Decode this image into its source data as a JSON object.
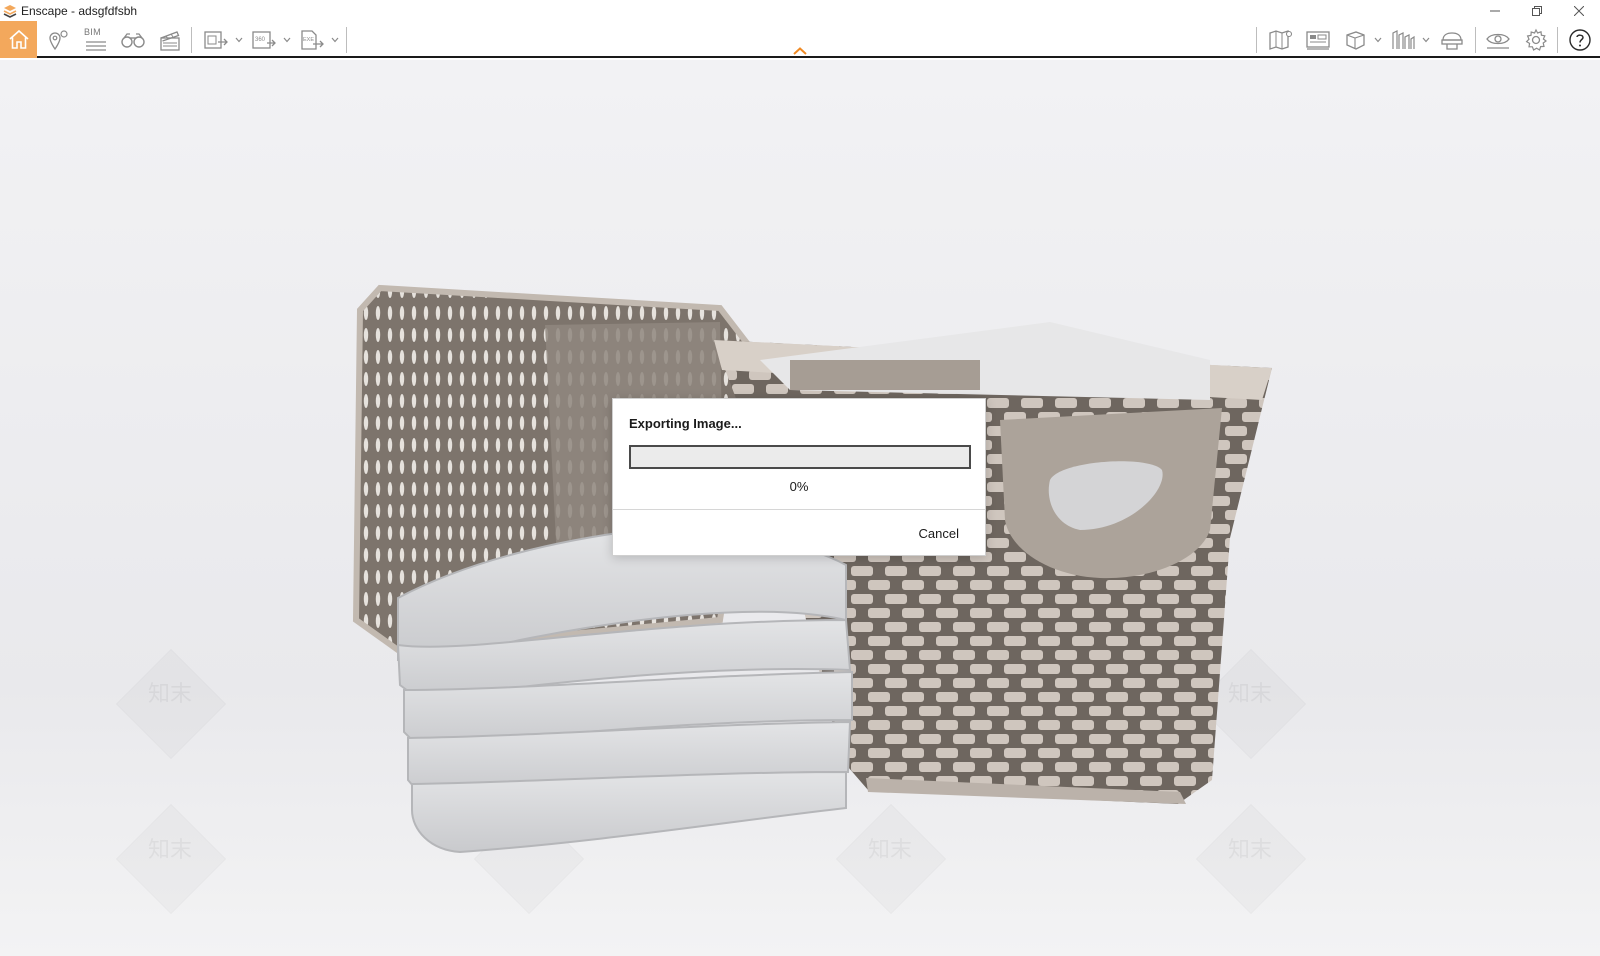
{
  "window": {
    "title": "Enscape - adsgfdfsbh"
  },
  "colors": {
    "accent": "#f3a85c",
    "toolbar_border": "#1a1a1a",
    "icon_gray": "#8a8a8a"
  },
  "toolbar": {
    "left_items": [
      {
        "name": "home-icon",
        "active": true
      },
      {
        "name": "location-pin-icon"
      },
      {
        "name": "bim-icon",
        "label": "BIM"
      },
      {
        "name": "binoculars-icon"
      },
      {
        "name": "clapperboard-icon"
      },
      {
        "name": "screenshot-export-icon",
        "has_dropdown": true
      },
      {
        "name": "panorama-360-icon",
        "has_dropdown": true
      },
      {
        "name": "exe-export-icon",
        "has_dropdown": true
      }
    ],
    "right_items": [
      {
        "name": "map-icon"
      },
      {
        "name": "asset-library-icon"
      },
      {
        "name": "cube-view-icon",
        "has_dropdown": true
      },
      {
        "name": "section-icon",
        "has_dropdown": true
      },
      {
        "name": "hat-icon"
      },
      {
        "name": "eye-icon"
      },
      {
        "name": "settings-gear-icon"
      },
      {
        "name": "help-icon"
      }
    ]
  },
  "render": {
    "subject": "woven-basket-with-folded-towels",
    "watermark_text": "知末"
  },
  "export_dialog": {
    "title": "Exporting Image...",
    "progress_value": 0,
    "progress_text": "0%",
    "cancel_label": "Cancel"
  }
}
